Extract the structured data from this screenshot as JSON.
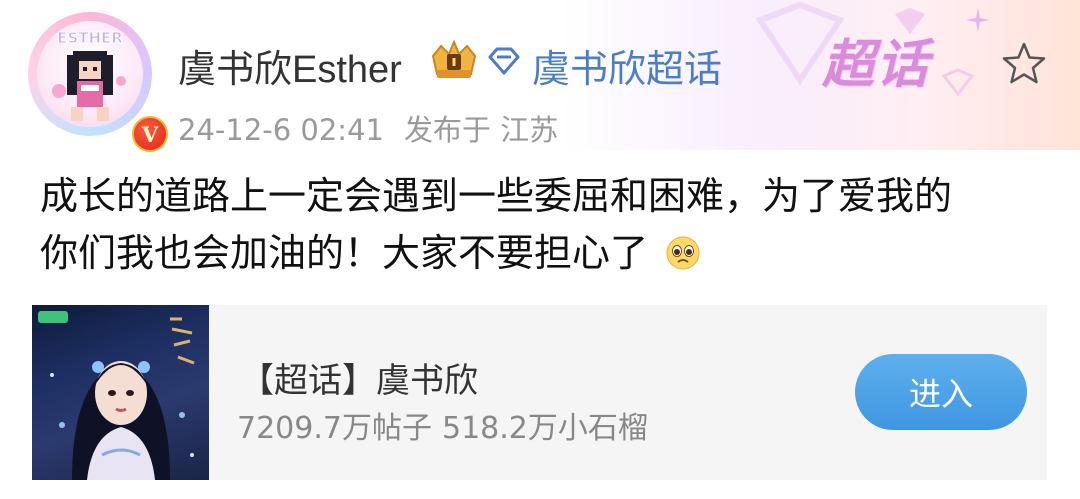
{
  "post": {
    "author": {
      "name": "虞书欣Esther",
      "avatar_text": "ESTHER",
      "verified_badge": "V",
      "level_icon": "crown-level-icon"
    },
    "topic_link": "虞书欣超话",
    "header_logo": "超话",
    "meta": {
      "timestamp": "24-12-6 02:41",
      "source": "发布于 江苏"
    },
    "text_lines": [
      "成长的道路上一定会遇到一些委屈和困难，为了爱我的",
      "你们我也会加油的！大家不要担心了"
    ],
    "emoji": "pleading-face-emoji"
  },
  "card": {
    "title": "【超话】虞书欣",
    "posts_count": "7209.7万帖子",
    "fans_count": "518.2万小石榴",
    "button_label": "进入"
  },
  "colors": {
    "accent": "#4a7ec6",
    "button": "#4a9ee6",
    "logo": "#d98bdc",
    "badge": "#e03a24"
  }
}
